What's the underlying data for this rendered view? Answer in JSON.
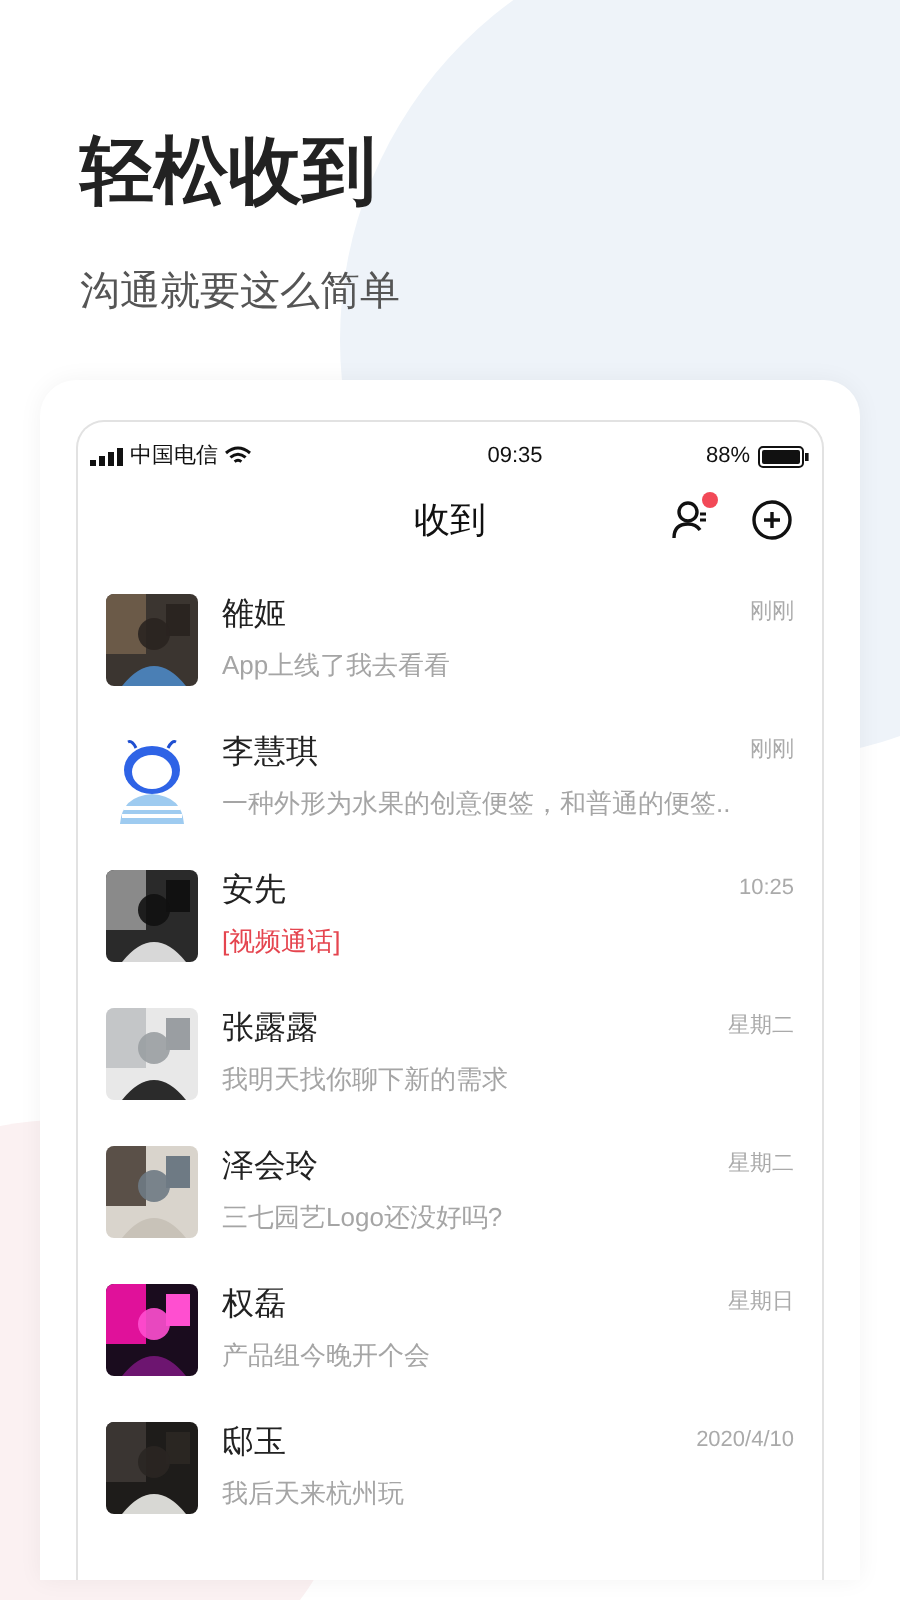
{
  "headline": "轻松收到",
  "tagline": "沟通就要这么简单",
  "status_bar": {
    "carrier": "中国电信",
    "time": "09:35",
    "battery": "88%"
  },
  "app_bar": {
    "title": "收到",
    "contacts_badge": true
  },
  "chats": [
    {
      "name": "雒姬",
      "time": "刚刚",
      "preview": "App上线了我去看看",
      "kind": "text"
    },
    {
      "name": "李慧琪",
      "time": "刚刚",
      "preview": "一种外形为水果的创意便签，和普通的便签..",
      "kind": "text",
      "avatar": {
        "kind": "cartoon"
      }
    },
    {
      "name": "安先",
      "time": "10:25",
      "preview": "[视频通话]",
      "kind": "call"
    },
    {
      "name": "张露露",
      "time": "星期二",
      "preview": "我明天找你聊下新的需求",
      "kind": "text"
    },
    {
      "name": "泽会玲",
      "time": "星期二",
      "preview": "三七园艺Logo还没好吗?",
      "kind": "text"
    },
    {
      "name": "权磊",
      "time": "星期日",
      "preview": "产品组今晚开个会",
      "kind": "text"
    },
    {
      "name": "邸玉",
      "time": "2020/4/10",
      "preview": "我后天来杭州玩",
      "kind": "text"
    }
  ]
}
